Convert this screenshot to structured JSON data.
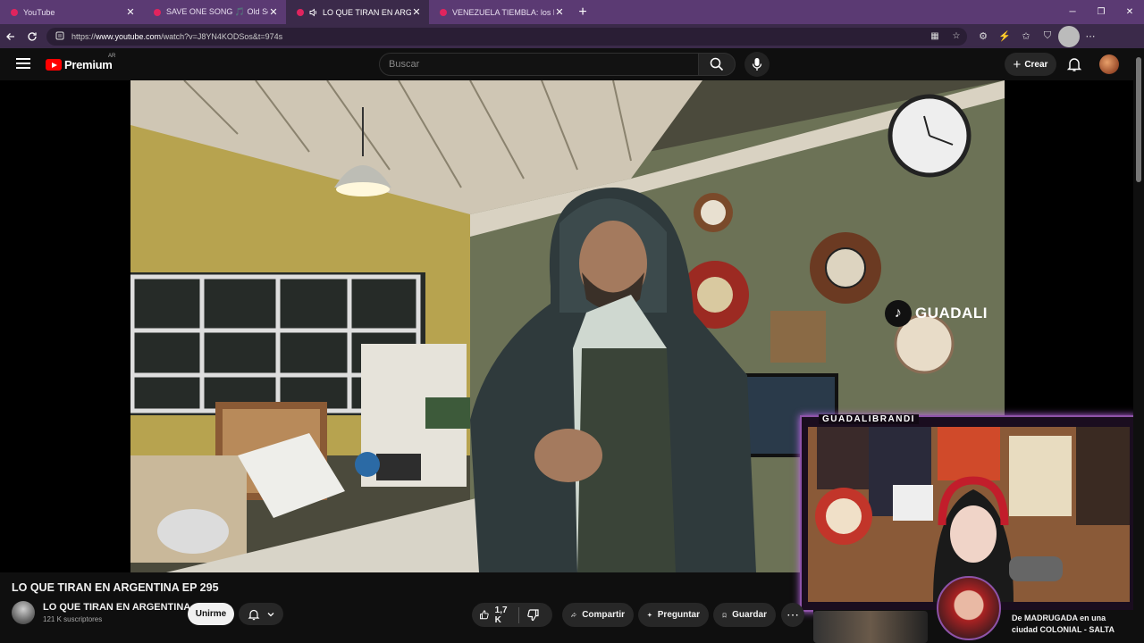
{
  "browser": {
    "tabs": [
      {
        "title": "YouTube",
        "active": false,
        "audio": false
      },
      {
        "title": "SAVE ONE SONG 🎵 Old Song vs",
        "active": false,
        "audio": false
      },
      {
        "title": "LO QUE TIRAN EN ARGENTINA",
        "active": true,
        "audio": true
      },
      {
        "title": "VENEZUELA TIEMBLA: los héroes c",
        "active": false,
        "audio": false
      }
    ],
    "close_glyph": "✕",
    "new_tab_glyph": "+",
    "url_prefix": "https://",
    "url_host": "www.youtube.com",
    "url_path": "/watch?v=J8YN4KODSos&t=974s",
    "window_controls": [
      "─",
      "❐",
      "✕"
    ]
  },
  "youtube": {
    "logo_text": "Premium",
    "country_code": "AR",
    "search_placeholder": "Buscar",
    "create_label": "Crear",
    "create_plus": "+"
  },
  "video": {
    "watermark": "GUADALI",
    "streamer_name": "GUADALIBRANDI",
    "title": "LO QUE TIRAN EN ARGENTINA EP 295",
    "channel_name": "LO QUE TIRAN EN ARGENTINA",
    "subscribers": "121 K suscriptores",
    "join_label": "Unirme",
    "likes": "1,7 K",
    "share_label": "Compartir",
    "ask_label": "Preguntar",
    "save_label": "Guardar",
    "more_glyph": "⋯"
  },
  "recommendation": {
    "line1": "De MADRUGADA en una",
    "line2": "ciudad COLONIAL - SALTA"
  },
  "colors": {
    "tabstrip": "#5b3a73",
    "active_tab": "#3b2a4a",
    "yt_red": "#ff0000",
    "overlay_border": "#8e53a8"
  }
}
